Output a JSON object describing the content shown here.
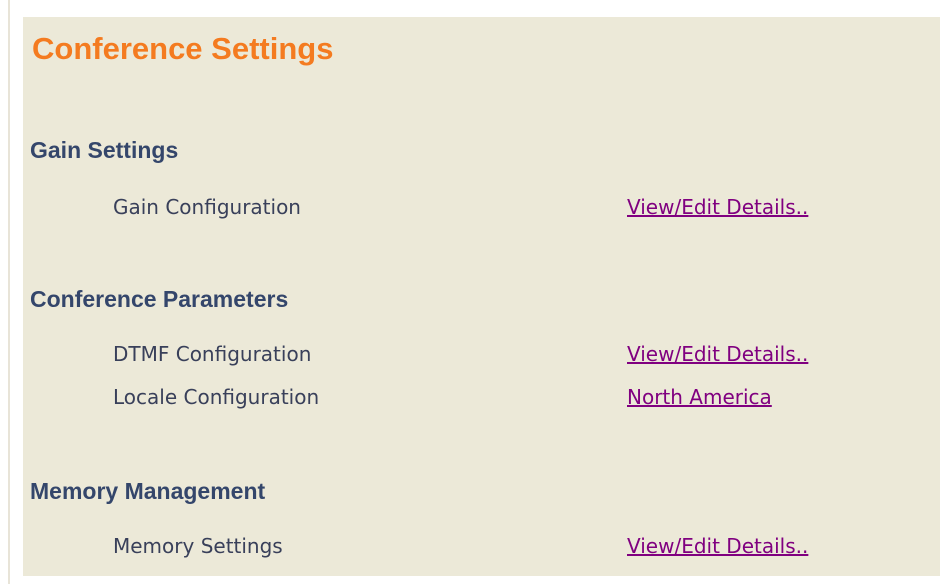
{
  "page": {
    "title": "Conference Settings"
  },
  "sections": [
    {
      "heading": "Gain Settings",
      "rows": [
        {
          "label": "Gain Configuration",
          "link": "View/Edit Details.."
        }
      ]
    },
    {
      "heading": "Conference Parameters",
      "rows": [
        {
          "label": "DTMF Configuration",
          "link": "View/Edit Details.."
        },
        {
          "label": "Locale Configuration",
          "link": "North America"
        }
      ]
    },
    {
      "heading": "Memory Management",
      "rows": [
        {
          "label": "Memory Settings",
          "link": "View/Edit Details.."
        }
      ]
    }
  ],
  "colors": {
    "panel_background": "#ece9d8",
    "title": "#f47b20",
    "heading": "#34466b",
    "label": "#39405a",
    "link_visited": "#800080"
  }
}
